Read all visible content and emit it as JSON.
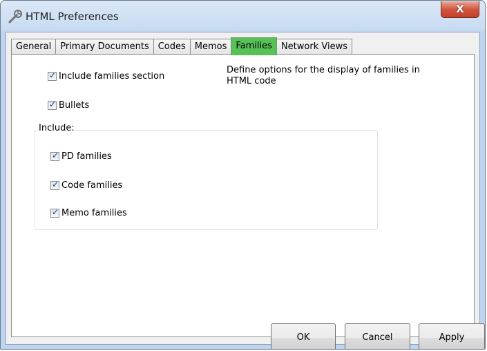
{
  "window": {
    "title": "HTML Preferences",
    "close_label": "X"
  },
  "tabs": [
    {
      "label": "General"
    },
    {
      "label": "Primary Documents"
    },
    {
      "label": "Codes"
    },
    {
      "label": "Memos"
    },
    {
      "label": "Families",
      "active": true
    },
    {
      "label": "Network Views"
    }
  ],
  "options": {
    "include_families_section": {
      "label": "Include families section",
      "checked": true
    },
    "bullets": {
      "label": "Bullets",
      "checked": true
    }
  },
  "description": "Define options for the display of families in HTML code",
  "include_group": {
    "label": "Include:",
    "items": [
      {
        "label": "PD families",
        "checked": true
      },
      {
        "label": "Code families",
        "checked": true
      },
      {
        "label": "Memo families",
        "checked": true
      }
    ]
  },
  "buttons": {
    "ok": "OK",
    "cancel": "Cancel",
    "apply": "Apply"
  },
  "colors": {
    "active_tab": "#57c157",
    "close_button": "#c4402b"
  }
}
